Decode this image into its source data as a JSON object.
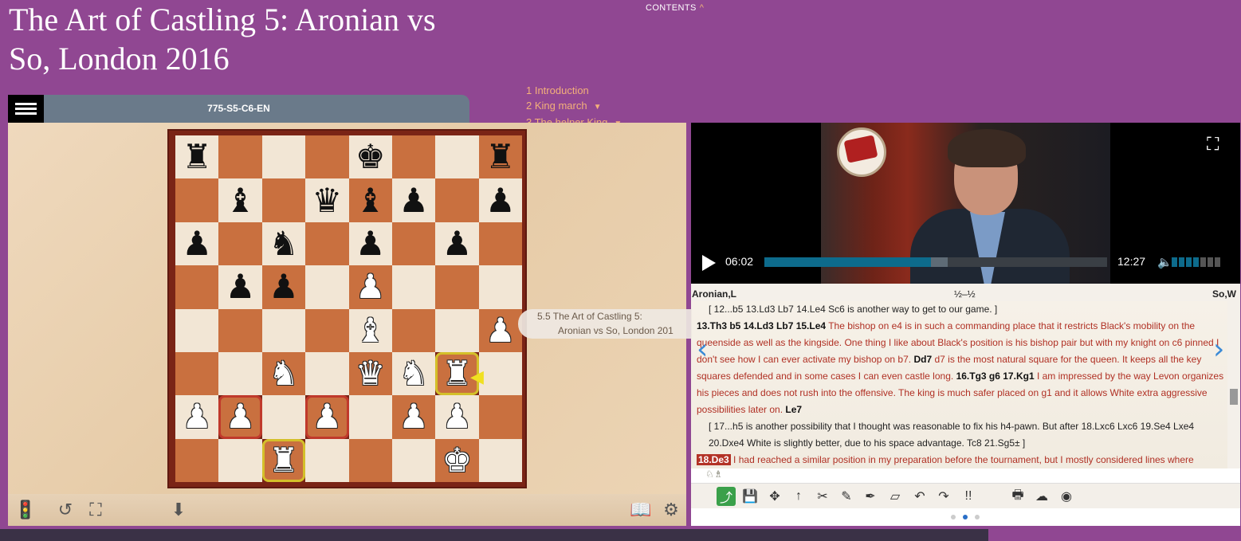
{
  "title": "The Art of Castling 5: Aronian vs So, London 2016",
  "contents_label": "CONTENTS",
  "toc": [
    {
      "num": "1",
      "label": "Introduction",
      "expandable": false
    },
    {
      "num": "2",
      "label": "King march",
      "expandable": true
    },
    {
      "num": "3",
      "label": "The helper King",
      "expandable": true
    }
  ],
  "board_header": {
    "id": "775-S5-C6-EN"
  },
  "board": {
    "ranks": [
      "8",
      "7",
      "6",
      "5",
      "4",
      "3",
      "2",
      "1"
    ],
    "files": [
      "a",
      "b",
      "c",
      "d",
      "e",
      "f",
      "g",
      "h"
    ],
    "position": [
      [
        "bR",
        "",
        "",
        "",
        "bK",
        "",
        "",
        "bR"
      ],
      [
        "",
        "bB",
        "",
        "bQ",
        "bB",
        "bP",
        "",
        "bP"
      ],
      [
        "bP",
        "",
        "bN",
        "",
        "bP",
        "",
        "bP",
        ""
      ],
      [
        "",
        "bP",
        "bP",
        "",
        "wP",
        "",
        "",
        ""
      ],
      [
        "",
        "",
        "",
        "",
        "wB",
        "",
        "",
        "wP"
      ],
      [
        "",
        "",
        "wN",
        "",
        "wQ",
        "wN",
        "wR",
        ""
      ],
      [
        "wP",
        "wP",
        "",
        "wP",
        "",
        "wP",
        "wP",
        ""
      ],
      [
        "",
        "",
        "wR",
        "",
        "",
        "",
        "wK",
        ""
      ]
    ],
    "highlights_red": [
      "b2",
      "d2"
    ],
    "highlights_yellow": [
      "c1",
      "g3"
    ]
  },
  "board_toolbar": {
    "icons": [
      "traffic-light-icon",
      "rotate-board-icon",
      "fullscreen-board-icon",
      "download-icon",
      "book-icon",
      "settings-icon"
    ]
  },
  "chapter_tooltip": {
    "line1": "5.5  The Art of Castling 5:",
    "line2": "Aronian vs So, London 201"
  },
  "video": {
    "current_time": "06:02",
    "total_time": "12:27",
    "progress": 0.485,
    "buffered": 0.535,
    "volume_bars_on": 4,
    "volume_bars_total": 7
  },
  "players": {
    "white": "Aronian,L",
    "result": "½–½",
    "black": "So,W"
  },
  "notation": {
    "line1": "[ 12...b5 13.Ld3 Lb7 14.Le4 Sc6 is another way to get to our game. ]",
    "line2_moves": "13.Th3 b5 14.Ld3 Lb7 15.Le4",
    "line2_comment": "The bishop on e4 is in such a commanding place that it restricts Black's mobility on the queenside as well as the kingside. One thing I like about Black's position is his bishop pair but with my knight on c6 pinned I don't see how I can ever activate my bishop on b7.",
    "move_dd7": "Dd7",
    "comment_dd7": "d7 is the most natural square for the queen. It keeps all the key squares defended and in some cases I can even castle long.",
    "move_tg3": "16.Tg3",
    "move_g6": "g6 17.Kg1",
    "comment_kg1": "I am impressed by the way Levon organizes his pieces and does not rush into the offensive. The king is much safer placed on g1 and it allows White extra aggressive possibilities later on.",
    "move_le7": "Le7",
    "var2": "[ 17...h5 is another possibility that I thought was reasonable to fix his h4-pawn. But after 18.Lxc6 Lxc6 19.Se4 Lxe4 20.Dxe4 White is slightly better, due to his space advantage.  Tc8 21.Sg5± ]",
    "current_move": "18.De3",
    "comment_de3": "I had reached a similar position in my preparation before the tournament, but I mostly considered lines where"
  },
  "pager": {
    "pages": 3,
    "active": 2
  }
}
